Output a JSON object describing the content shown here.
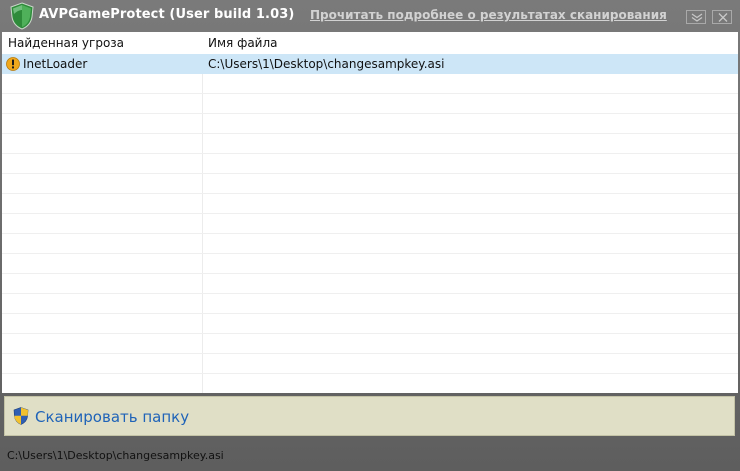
{
  "window": {
    "title": "AVPGameProtect (User build 1.03)",
    "report_link": "Прочитать подробнее о результатах сканирования",
    "app_icon": "shield-icon",
    "controls": {
      "minimize": "chevron-down-icon",
      "close": "close-icon"
    }
  },
  "table": {
    "columns": [
      "Найденная угроза",
      "Имя файла"
    ],
    "rows": [
      {
        "threat": "InetLoader",
        "file": "C:\\Users\\1\\Desktop\\changesampkey.asi",
        "icon": "warning-icon",
        "selected": true
      }
    ]
  },
  "actions": {
    "scan_label": "Сканировать папку",
    "scan_icon": "uac-shield-icon"
  },
  "status": {
    "text": "C:\\Users\\1\\Desktop\\changesampkey.asi"
  },
  "colors": {
    "selection": "#cde6f7",
    "action_bar": "#e0dfc6",
    "link_blue": "#1f63b8"
  }
}
